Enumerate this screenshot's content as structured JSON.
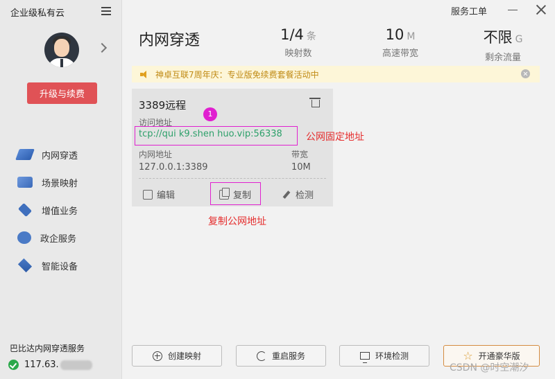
{
  "app": {
    "brand": "企业级私有云",
    "service_order": "服务工单"
  },
  "sidebar": {
    "upgrade_label": "升级与续费",
    "items": [
      {
        "label": "内网穿透"
      },
      {
        "label": "场景映射"
      },
      {
        "label": "增值业务"
      },
      {
        "label": "政企服务"
      },
      {
        "label": "智能设备"
      }
    ],
    "service_name": "巴比达内网穿透服务",
    "ip_prefix": "117.63."
  },
  "header": {
    "title": "内网穿透",
    "stats": [
      {
        "value": "1/4",
        "unit": "条",
        "label": "映射数"
      },
      {
        "value": "10",
        "unit": "M",
        "label": "高速带宽"
      },
      {
        "value": "不限",
        "unit": "G",
        "label": "剩余流量"
      }
    ]
  },
  "notice": {
    "text": "神卓互联7周年庆：专业版免续费套餐活动中"
  },
  "card": {
    "title": "3389远程",
    "access_label": "访问地址",
    "access_address": "tcp://qui  k9.shen  huo.vip:56338",
    "internal_label": "内网地址",
    "internal_value": "127.0.0.1:3389",
    "bandwidth_label": "带宽",
    "bandwidth_value": "10M",
    "actions": {
      "edit": "编辑",
      "copy": "复制",
      "test": "检测"
    }
  },
  "annotations": {
    "marker": "1",
    "public_fixed": "公网固定地址",
    "copy_public": "复制公网地址"
  },
  "bottom": {
    "create": "创建映射",
    "restart": "重启服务",
    "env_check": "环境检测",
    "deluxe": "开通豪华版"
  },
  "watermark": "CSDN @时空潮汐"
}
